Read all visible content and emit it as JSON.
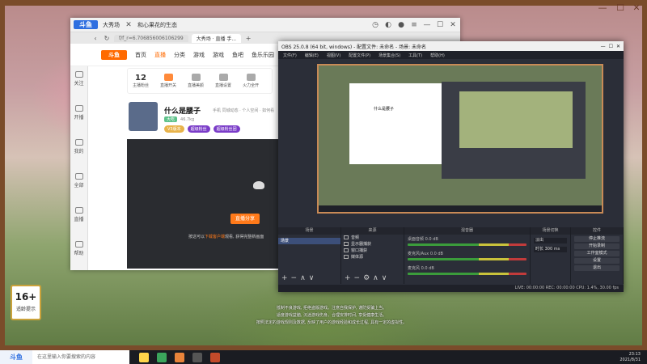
{
  "browser": {
    "title": "大秀场",
    "url_fragment": "f/f_r=6.706856006106299",
    "tab_label": "大秀场 · 直播 手...",
    "tab2_label": "和心果花的生态",
    "nav": [
      "首页",
      "直播",
      "分类",
      "游戏",
      "游戏",
      "鱼吧",
      "鱼乐乐园"
    ]
  },
  "stats": {
    "level": "12",
    "level_label": "主播粉丝",
    "items": [
      "直播开关",
      "直播美颜",
      "直播设置",
      "火力全开"
    ]
  },
  "anchor": {
    "name": "什么是腰子",
    "meta": "手机   同城动态 · 个人空间 · 如何看",
    "tag": "大吃",
    "fans": "46.7kg",
    "pills": [
      "V3版本",
      "超级粉丝",
      "超级粉丝团"
    ],
    "footer_name": "合吧",
    "footer_name2": "心吃"
  },
  "player": {
    "cta": "直播分享",
    "hint_prefix": "按这可以",
    "hint_highlight": "下载客户端",
    "hint_suffix": "观看, 获得完整新画面"
  },
  "sidebar": {
    "items": [
      "关注",
      "开播",
      "我的",
      "全部",
      "直播",
      "帮助"
    ]
  },
  "obs": {
    "title": "OBS 25.0.8 (64 bit, windows) - 配置文件: 未命名 - 场景: 未命名",
    "menu": [
      "文件(F)",
      "编辑(E)",
      "视图(V)",
      "配置文件(P)",
      "场景集合(S)",
      "工具(T)",
      "帮助(H)"
    ],
    "dock_scenes": "场景",
    "dock_sources": "来源",
    "dock_mixer": "混音器",
    "dock_transitions": "场景切换",
    "dock_controls": "控件",
    "scene_selected": "场景",
    "sources": [
      "音频",
      "显示器捕获",
      "窗口捕获",
      "媒体源"
    ],
    "mixer_tracks": [
      "桌面音频",
      "麦克风/Aux",
      "麦克风"
    ],
    "db_value": "0.0 dB",
    "transition": "淡出",
    "duration_label": "时长",
    "duration_value": "300 ms",
    "controls": [
      "停止推流",
      "开始录制",
      "工作室模式",
      "设置",
      "退出"
    ],
    "status": "LIVE: 00:00:00   REC: 00:00:00   CPU: 1.4%, 30.00 fps"
  },
  "rating": {
    "age": "16+",
    "tip": "适龄提示"
  },
  "subtitles": [
    "抵制不良游戏, 拒绝盗版游戏。注意自我保护, 谨防受骗上当。",
    "适度游戏益脑, 沉迷游戏伤身。合理安排时间, 享受健康生活。",
    "按照法定的游戏规则及数据, 反映了用户的游戏经验和成长过程, 具有一定的虚拟性。"
  ],
  "taskbar": {
    "search_placeholder": "在这里输入你要搜索的内容",
    "time": "23:13",
    "date": "2021/8/31"
  }
}
